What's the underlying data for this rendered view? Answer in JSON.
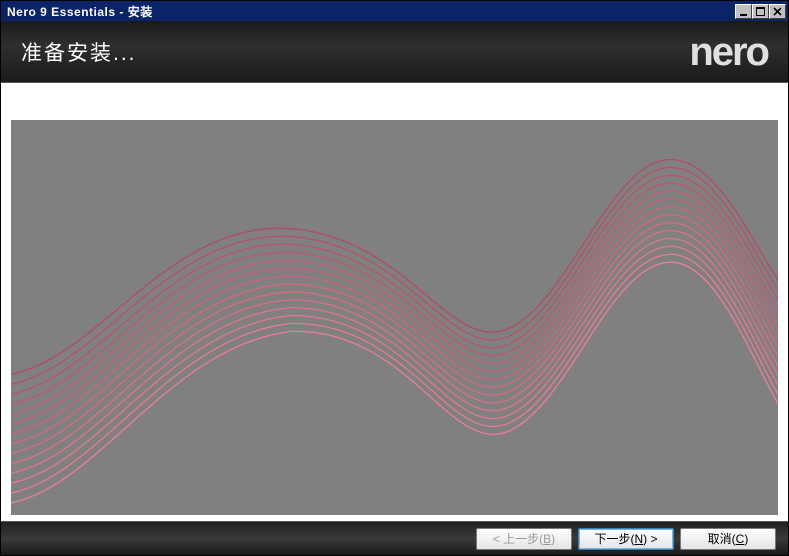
{
  "window": {
    "title": "Nero 9 Essentials - 安装"
  },
  "header": {
    "heading": "准备安装...",
    "logo_text": "nero"
  },
  "footer": {
    "back_label_prefix": "< 上一步(",
    "back_hotkey": "B",
    "back_label_suffix": ")",
    "next_label_prefix": "下一步(",
    "next_hotkey": "N",
    "next_label_suffix": ") >",
    "cancel_label_prefix": "取消(",
    "cancel_hotkey": "C",
    "cancel_label_suffix": ")"
  }
}
